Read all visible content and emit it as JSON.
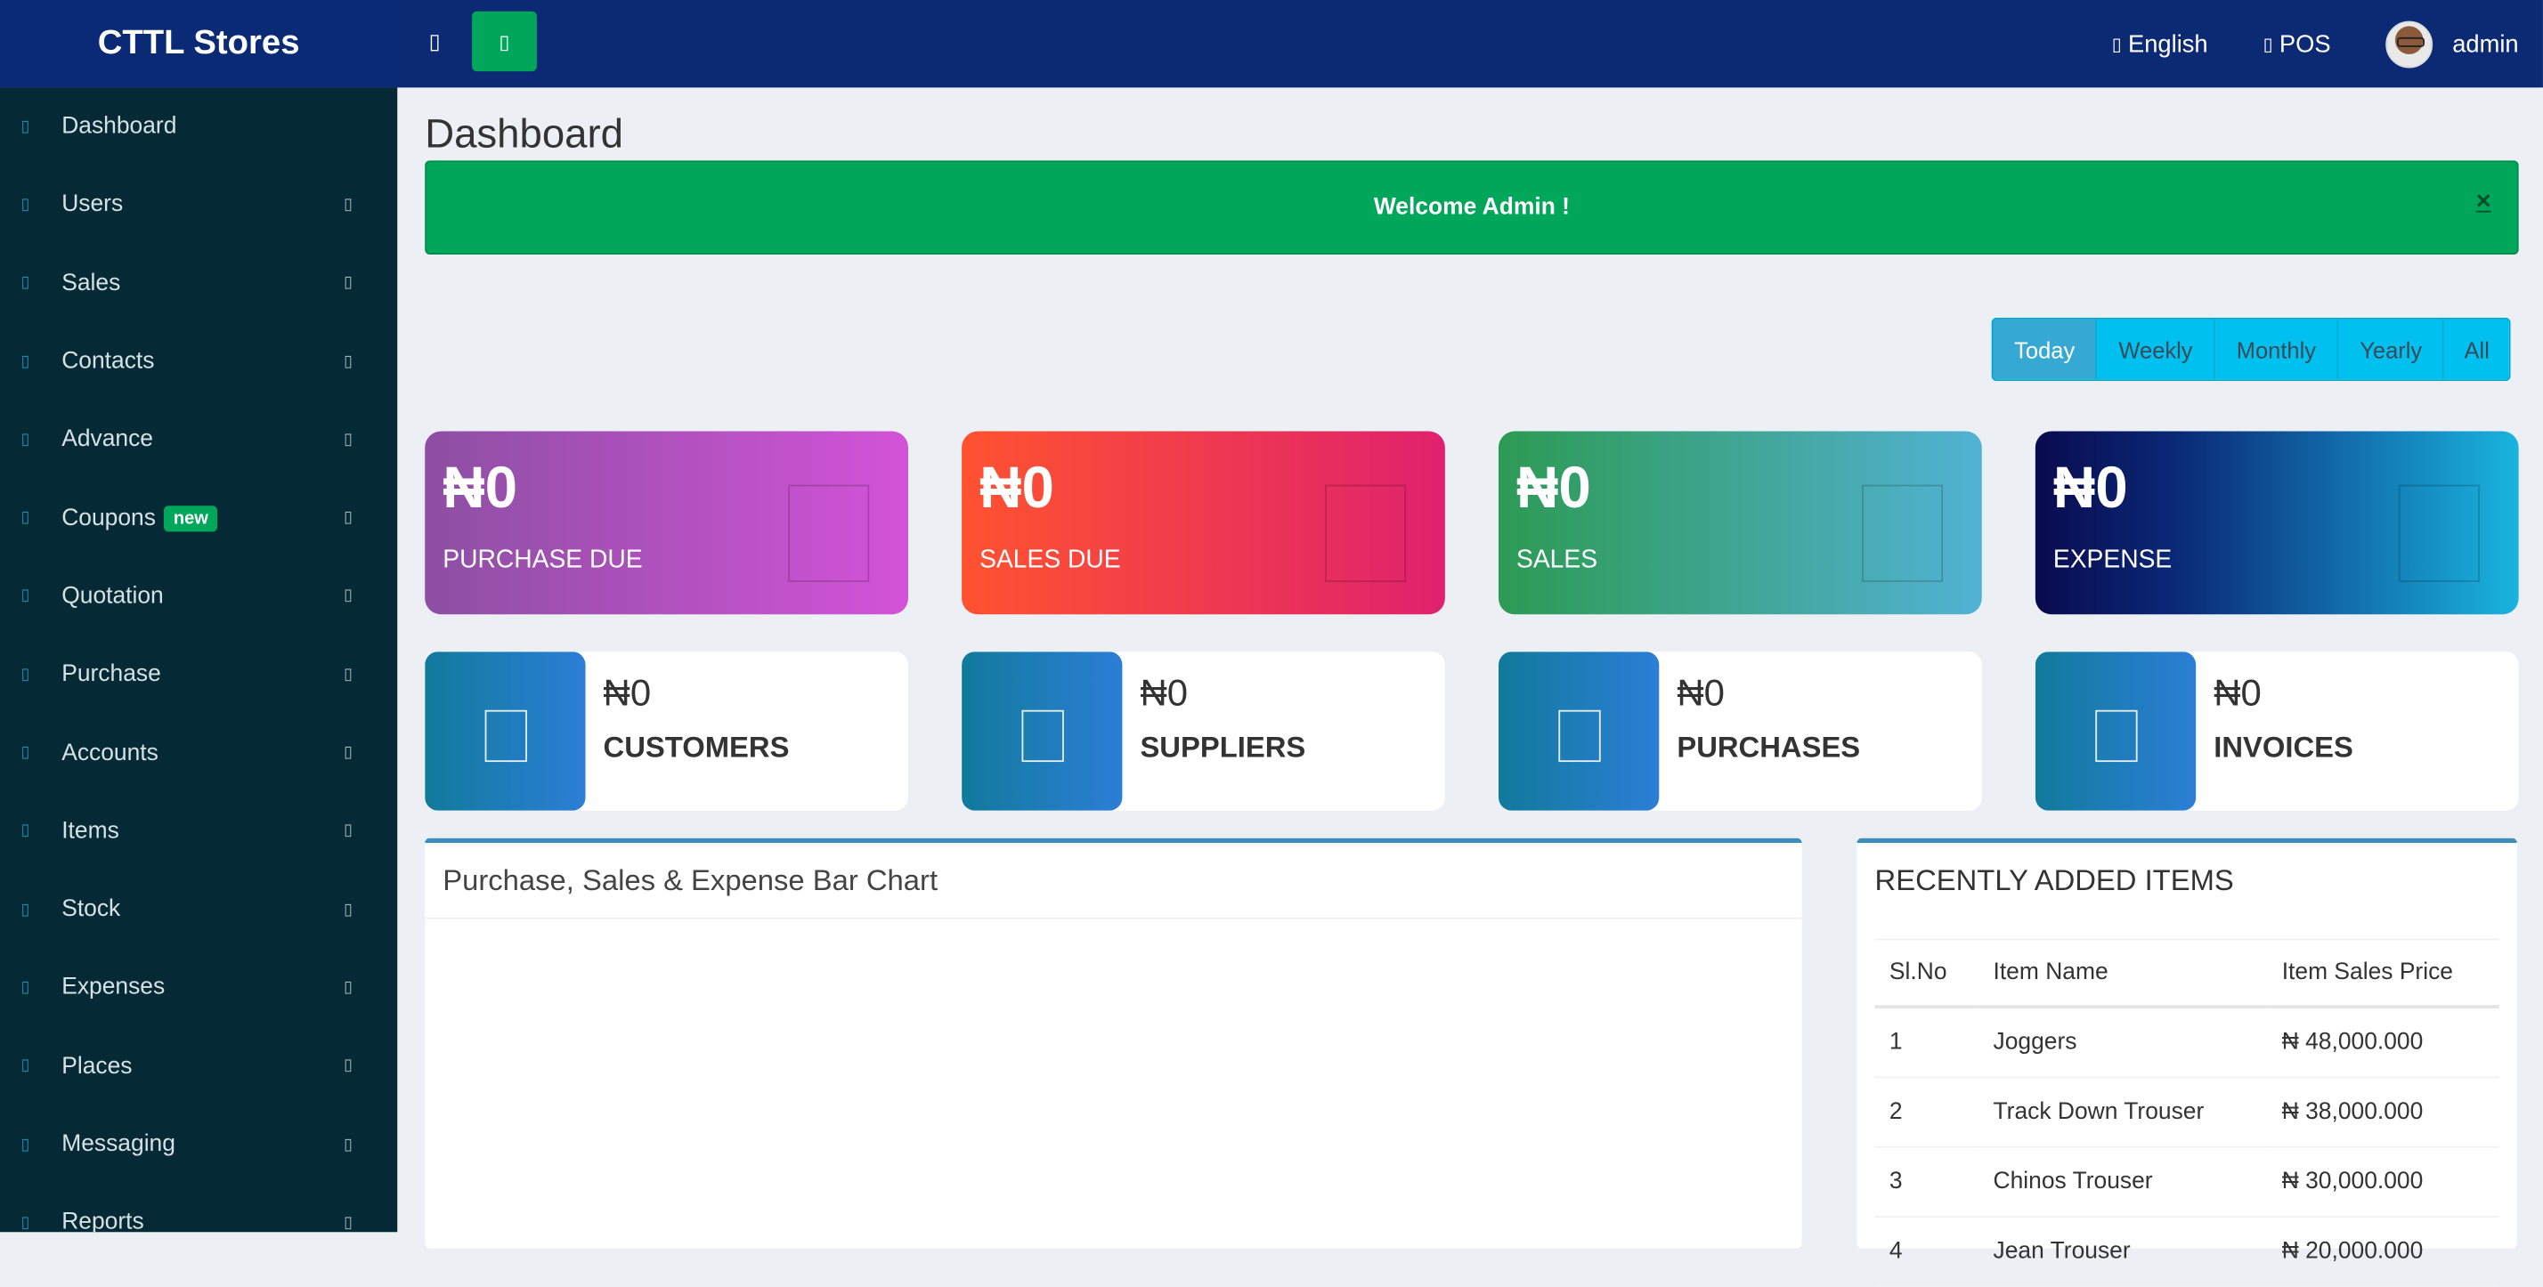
{
  "brand": "CTTL Stores",
  "topbar": {
    "menu_toggle_icon": "bars-icon",
    "quick_button_icon": "calculator-icon",
    "language_label": "English",
    "pos_label": "POS",
    "user_name": "admin"
  },
  "sidebar": {
    "items": [
      {
        "label": "Dashboard",
        "has_submenu": false
      },
      {
        "label": "Users",
        "has_submenu": true
      },
      {
        "label": "Sales",
        "has_submenu": true
      },
      {
        "label": "Contacts",
        "has_submenu": true
      },
      {
        "label": "Advance",
        "has_submenu": true
      },
      {
        "label": "Coupons",
        "badge": "new",
        "has_submenu": true
      },
      {
        "label": "Quotation",
        "has_submenu": true
      },
      {
        "label": "Purchase",
        "has_submenu": true
      },
      {
        "label": "Accounts",
        "has_submenu": true
      },
      {
        "label": "Items",
        "has_submenu": true
      },
      {
        "label": "Stock",
        "has_submenu": true
      },
      {
        "label": "Expenses",
        "has_submenu": true
      },
      {
        "label": "Places",
        "has_submenu": true
      },
      {
        "label": "Messaging",
        "has_submenu": true
      },
      {
        "label": "Reports",
        "has_submenu": true
      }
    ]
  },
  "page_title": "Dashboard",
  "alert": {
    "message": "Welcome Admin !",
    "close": "×"
  },
  "periods": {
    "items": [
      "Today",
      "Weekly",
      "Monthly",
      "Yearly",
      "All"
    ],
    "active": "Today"
  },
  "stats": [
    {
      "value": "₦0",
      "label": "PURCHASE DUE"
    },
    {
      "value": "₦0",
      "label": "SALES DUE"
    },
    {
      "value": "₦0",
      "label": "SALES"
    },
    {
      "value": "₦0",
      "label": "EXPENSE"
    }
  ],
  "info_boxes": [
    {
      "value": "₦0",
      "label": "CUSTOMERS"
    },
    {
      "value": "₦0",
      "label": "SUPPLIERS"
    },
    {
      "value": "₦0",
      "label": "PURCHASES"
    },
    {
      "value": "₦0",
      "label": "INVOICES"
    }
  ],
  "chart_panel": {
    "title": "Purchase, Sales & Expense Bar Chart"
  },
  "recent_items": {
    "title": "RECENTLY ADDED ITEMS",
    "columns": [
      "Sl.No",
      "Item Name",
      "Item Sales Price"
    ],
    "rows": [
      [
        "1",
        "Joggers",
        "₦ 48,000.000"
      ],
      [
        "2",
        "Track Down Trouser",
        "₦ 38,000.000"
      ],
      [
        "3",
        "Chinos Trouser",
        "₦ 30,000.000"
      ],
      [
        "4",
        "Jean Trouser",
        "₦ 20,000.000"
      ]
    ]
  },
  "colors": {
    "topbar": "#0c2a74",
    "sidebar": "#052a35",
    "alert": "#00a65a",
    "period_button": "#00c0ef",
    "panel_accent": "#3c8dbc"
  }
}
